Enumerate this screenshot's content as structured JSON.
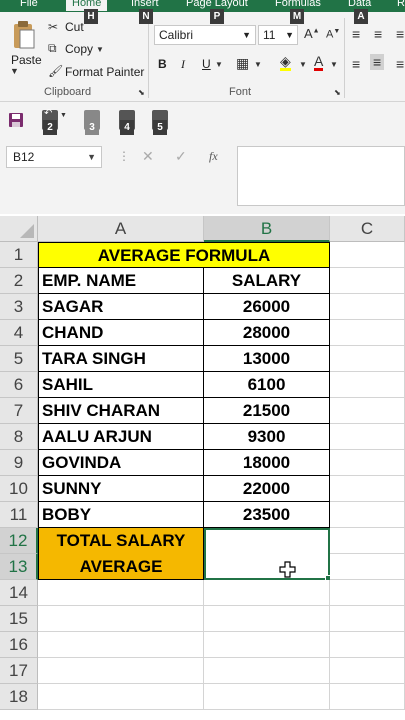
{
  "ribbon": {
    "tabs": [
      {
        "label": "File",
        "keytip": ""
      },
      {
        "label": "Home",
        "keytip": "H"
      },
      {
        "label": "Insert",
        "keytip": "N"
      },
      {
        "label": "Page Layout",
        "keytip": "P"
      },
      {
        "label": "Formulas",
        "keytip": "M"
      },
      {
        "label": "Data",
        "keytip": "A"
      },
      {
        "label": "R",
        "keytip": ""
      }
    ],
    "clipboard": {
      "paste": "Paste",
      "cut": "Cut",
      "copy": "Copy",
      "format_painter": "Format Painter",
      "group_label": "Clipboard"
    },
    "font": {
      "name": "Calibri",
      "size": "11",
      "bold": "B",
      "italic": "I",
      "underline": "U",
      "group_label": "Font"
    }
  },
  "qat": {
    "badges": [
      "2",
      "3",
      "4",
      "5"
    ]
  },
  "formula_bar": {
    "name_box": "B12",
    "fx": "fx",
    "value": ""
  },
  "sheet": {
    "columns": [
      "A",
      "B",
      "C"
    ],
    "rows": [
      "1",
      "2",
      "3",
      "4",
      "5",
      "6",
      "7",
      "8",
      "9",
      "10",
      "11",
      "12",
      "13",
      "14",
      "15",
      "16",
      "17",
      "18"
    ],
    "title": "AVERAGE FORMULA",
    "headers": {
      "name": "EMP. NAME",
      "salary": "SALARY"
    },
    "employees": [
      {
        "name": "SAGAR",
        "salary": "26000"
      },
      {
        "name": "CHAND",
        "salary": "28000"
      },
      {
        "name": "TARA SINGH",
        "salary": "13000"
      },
      {
        "name": "SAHIL",
        "salary": "6100"
      },
      {
        "name": "SHIV CHARAN",
        "salary": "21500"
      },
      {
        "name": "AALU ARJUN",
        "salary": "9300"
      },
      {
        "name": "GOVINDA",
        "salary": "18000"
      },
      {
        "name": "SUNNY",
        "salary": "22000"
      },
      {
        "name": "BOBY",
        "salary": "23500"
      }
    ],
    "total_label_line1": "TOTAL SALARY",
    "total_label_line2": "AVERAGE",
    "colors": {
      "title_fill": "#ffff00",
      "total_fill": "#f5b800",
      "accent": "#217346"
    }
  }
}
